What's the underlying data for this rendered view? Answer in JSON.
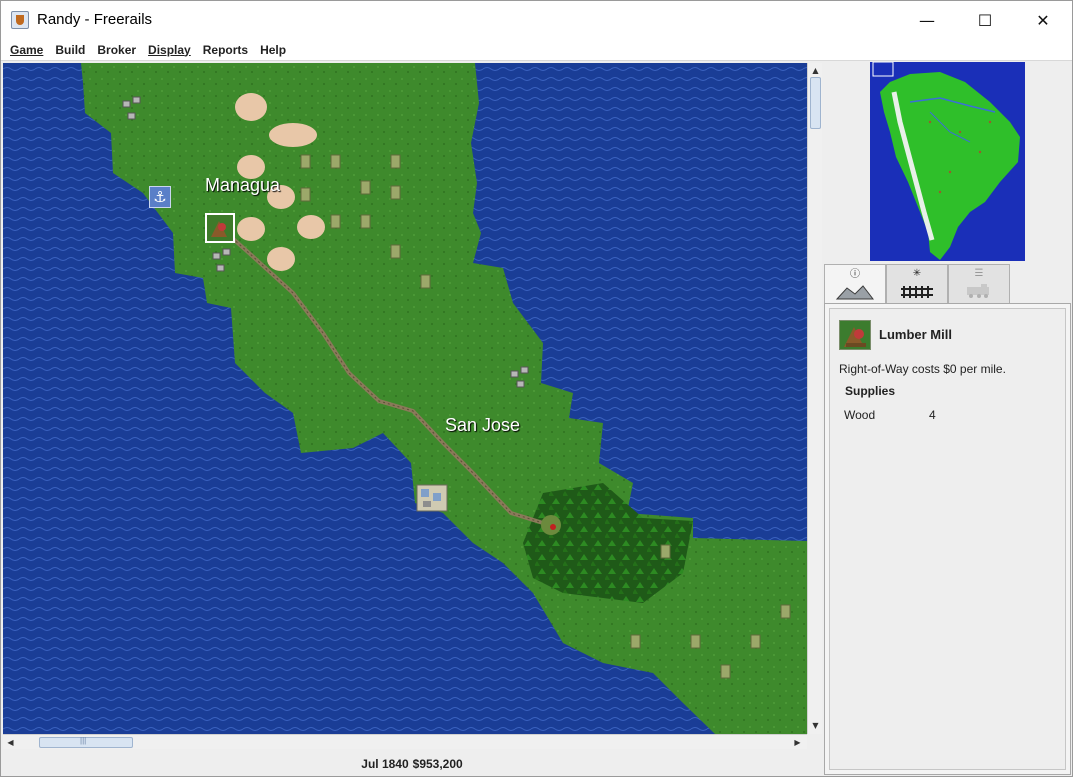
{
  "window": {
    "title": "Randy - Freerails",
    "controls": {
      "minimize": "—",
      "maximize": "☐",
      "close": "✕"
    }
  },
  "menu": [
    {
      "label": "Game",
      "underlined": true
    },
    {
      "label": "Build",
      "underlined": false
    },
    {
      "label": "Broker",
      "underlined": false
    },
    {
      "label": "Display",
      "underlined": true
    },
    {
      "label": "Reports",
      "underlined": false
    },
    {
      "label": "Help",
      "underlined": false
    }
  ],
  "map": {
    "cities": [
      {
        "name": "Managua"
      },
      {
        "name": "San Jose"
      }
    ],
    "icons": {
      "port": "anchor-icon",
      "selected_tile": "lumber-mill-icon"
    },
    "colors": {
      "ocean": "#1a3d96",
      "land": "#3e8a2c",
      "track": "#8a7a5a",
      "desert": "#e8c7a8"
    }
  },
  "status": {
    "date": "Jul 1840",
    "money": "$953,200"
  },
  "tabs": [
    {
      "name": "terrain-info-tab",
      "symbol": "ⓘ",
      "active": true
    },
    {
      "name": "track-tab",
      "symbol": "✳",
      "active": false
    },
    {
      "name": "train-list-tab",
      "symbol": "☰",
      "active": false
    }
  ],
  "info": {
    "title": "Lumber Mill",
    "cost_text": "Right-of-Way costs $0 per mile.",
    "supplies_heading": "Supplies",
    "supplies": [
      {
        "cargo": "Wood",
        "qty": "4"
      }
    ]
  },
  "minimap": {
    "colors": {
      "ocean": "#1a2fb8",
      "land": "#2fbf2a",
      "mountains": "#e8f0e8",
      "rivers": "#3b6fd8"
    }
  }
}
